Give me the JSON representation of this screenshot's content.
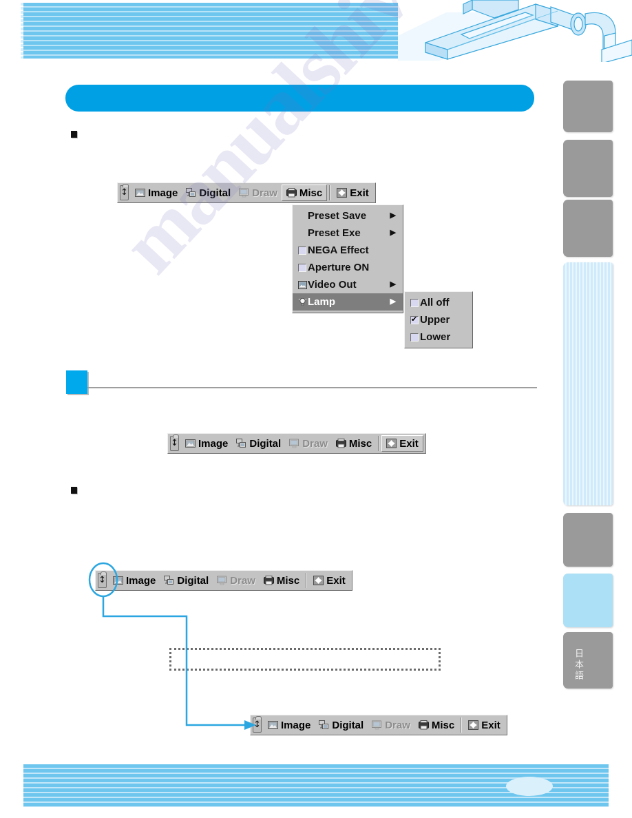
{
  "page": {
    "title_banner": "",
    "section_number": "",
    "note_box_text": "",
    "footer_page_number": ""
  },
  "sidebar": {
    "tabs": [
      {
        "name": "tab-1",
        "label": "",
        "style": "gray"
      },
      {
        "name": "tab-2",
        "label": "",
        "style": "gray"
      },
      {
        "name": "tab-3",
        "label": "",
        "style": "gray"
      },
      {
        "name": "tab-4",
        "label": "",
        "style": "striped"
      },
      {
        "name": "tab-5",
        "label": "",
        "style": "gray"
      },
      {
        "name": "tab-6",
        "label": "",
        "style": "lightblue"
      },
      {
        "name": "tab-japanese",
        "label": "日本語",
        "style": "gray"
      }
    ]
  },
  "bullets": [
    {
      "text": ""
    },
    {
      "text": ""
    }
  ],
  "toolbar": {
    "grip_icon": "drag-handle-icon",
    "items": [
      {
        "label": "Image",
        "icon": "image-icon",
        "state": "normal"
      },
      {
        "label": "Digital",
        "icon": "digital-icon",
        "state": "normal"
      },
      {
        "label": "Draw",
        "icon": "draw-icon",
        "state": "disabled"
      },
      {
        "label": "Misc",
        "icon": "misc-icon",
        "state": "normal"
      },
      {
        "label": "Exit",
        "icon": "exit-icon",
        "state": "normal"
      }
    ]
  },
  "toolbars": {
    "top": {
      "pressed": "Misc"
    },
    "second": {
      "pressed": "Exit"
    },
    "third": {
      "pressed": ""
    },
    "bottom": {
      "pressed": ""
    }
  },
  "misc_menu": {
    "items": [
      {
        "label": "Preset Save",
        "icon": "",
        "type": "submenu",
        "checked": false
      },
      {
        "label": "Preset Exe",
        "icon": "",
        "type": "submenu",
        "checked": false
      },
      {
        "label": "NEGA Effect",
        "icon": "checkbox",
        "type": "checkbox",
        "checked": false
      },
      {
        "label": "Aperture ON",
        "icon": "checkbox",
        "type": "checkbox",
        "checked": false
      },
      {
        "label": "Video Out",
        "icon": "video-icon",
        "type": "submenu",
        "checked": false
      },
      {
        "label": "Lamp",
        "icon": "lamp-icon",
        "type": "submenu",
        "checked": false,
        "highlighted": true
      }
    ]
  },
  "lamp_submenu": {
    "items": [
      {
        "label": "All off",
        "checked": false
      },
      {
        "label": "Upper",
        "checked": true
      },
      {
        "label": "Lower",
        "checked": false
      }
    ]
  },
  "watermark": {
    "text": "manualshive.com"
  },
  "colors": {
    "banner_blue": "#00a0e4",
    "section_box_blue": "#00a8ec",
    "callout_blue": "#2ba6e0",
    "stripe_blue": "#6ec6ee",
    "tab_gray": "#9a9a9a",
    "toolbar_face": "#c3c3c3",
    "menu_highlight": "#7e7e7e"
  }
}
